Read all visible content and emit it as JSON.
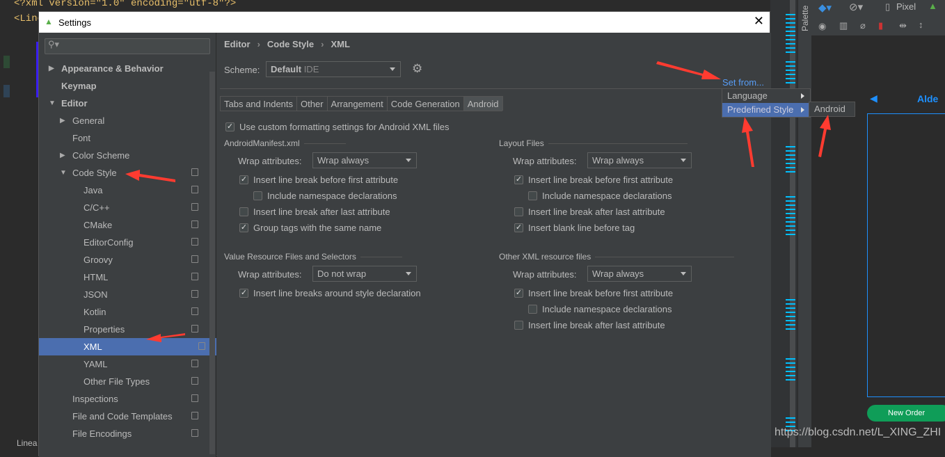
{
  "editor_bg": {
    "line1": "<?xml version=\"1.0\" encoding=\"utf-8\"?>",
    "line2": "<Line",
    "bottom_text": "Linea"
  },
  "dialog": {
    "title": "Settings",
    "close_icon": "close-icon",
    "app_icon": "android-icon"
  },
  "tree": {
    "items": [
      {
        "label": "Appearance & Behavior",
        "level": 0,
        "arrow": "collapsed",
        "bold": true
      },
      {
        "label": "Keymap",
        "level": 0,
        "arrow": "none",
        "bold": true
      },
      {
        "label": "Editor",
        "level": 0,
        "arrow": "expanded",
        "bold": true
      },
      {
        "label": "General",
        "level": 1,
        "arrow": "collapsed"
      },
      {
        "label": "Font",
        "level": 1,
        "arrow": "none"
      },
      {
        "label": "Color Scheme",
        "level": 1,
        "arrow": "collapsed"
      },
      {
        "label": "Code Style",
        "level": 1,
        "arrow": "expanded",
        "copy": true
      },
      {
        "label": "Java",
        "level": 2,
        "copy": true
      },
      {
        "label": "C/C++",
        "level": 2,
        "copy": true
      },
      {
        "label": "CMake",
        "level": 2,
        "copy": true
      },
      {
        "label": "EditorConfig",
        "level": 2,
        "copy": true
      },
      {
        "label": "Groovy",
        "level": 2,
        "copy": true
      },
      {
        "label": "HTML",
        "level": 2,
        "copy": true
      },
      {
        "label": "JSON",
        "level": 2,
        "copy": true
      },
      {
        "label": "Kotlin",
        "level": 2,
        "copy": true
      },
      {
        "label": "Properties",
        "level": 2,
        "copy": true
      },
      {
        "label": "XML",
        "level": 2,
        "copy": true,
        "selected": true
      },
      {
        "label": "YAML",
        "level": 2,
        "copy": true
      },
      {
        "label": "Other File Types",
        "level": 2,
        "copy": true
      },
      {
        "label": "Inspections",
        "level": 1,
        "copy": true
      },
      {
        "label": "File and Code Templates",
        "level": 1,
        "copy": true
      },
      {
        "label": "File Encodings",
        "level": 1,
        "copy": true
      }
    ]
  },
  "breadcrumb": [
    "Editor",
    "Code Style",
    "XML"
  ],
  "scheme": {
    "label": "Scheme:",
    "value": "Default",
    "tag": "IDE"
  },
  "set_from": "Set from...",
  "tabs": [
    "Tabs and Indents",
    "Other",
    "Arrangement",
    "Code Generation",
    "Android"
  ],
  "active_tab": "Android",
  "use_custom": {
    "label": "Use custom formatting settings for Android XML files",
    "checked": true
  },
  "sections": [
    {
      "title": "AndroidManifest.xml",
      "wrap_label": "Wrap attributes:",
      "wrap_value": "Wrap always",
      "options": [
        {
          "label": "Insert line break before first attribute",
          "checked": true,
          "indent": 0
        },
        {
          "label": "Include namespace declarations",
          "checked": false,
          "indent": 1
        },
        {
          "label": "Insert line break after last attribute",
          "checked": false,
          "indent": 0
        },
        {
          "label": "Group tags with the same name",
          "checked": true,
          "indent": 0
        }
      ]
    },
    {
      "title": "Layout Files",
      "wrap_label": "Wrap attributes:",
      "wrap_value": "Wrap always",
      "options": [
        {
          "label": "Insert line break before first attribute",
          "checked": true,
          "indent": 0
        },
        {
          "label": "Include namespace declarations",
          "checked": false,
          "indent": 1
        },
        {
          "label": "Insert line break after last attribute",
          "checked": false,
          "indent": 0
        },
        {
          "label": "Insert blank line before tag",
          "checked": true,
          "indent": 0
        }
      ]
    },
    {
      "title": "Value Resource Files and Selectors",
      "wrap_label": "Wrap attributes:",
      "wrap_value": "Do not wrap",
      "options": [
        {
          "label": "Insert line breaks around style declaration",
          "checked": true,
          "indent": 0
        }
      ]
    },
    {
      "title": "Other XML resource files",
      "wrap_label": "Wrap attributes:",
      "wrap_value": "Wrap always",
      "options": [
        {
          "label": "Insert line break before first attribute",
          "checked": true,
          "indent": 0
        },
        {
          "label": "Include namespace declarations",
          "checked": false,
          "indent": 1
        },
        {
          "label": "Insert line break after last attribute",
          "checked": false,
          "indent": 0
        }
      ]
    }
  ],
  "popup": {
    "items": [
      "Language",
      "Predefined Style"
    ],
    "highlighted": "Predefined Style",
    "submenu": [
      "Android"
    ]
  },
  "designer": {
    "palette": "Palette",
    "device": "Pixel",
    "title_partial": "Alde",
    "button": "New Order"
  },
  "watermark": "https://blog.csdn.net/L_XING_ZHI",
  "colors": {
    "accent": "#4b6eaf",
    "link": "#589df6",
    "arrow": "#ff3b30",
    "guide": "#00c0ff",
    "button": "#0f9d58"
  }
}
